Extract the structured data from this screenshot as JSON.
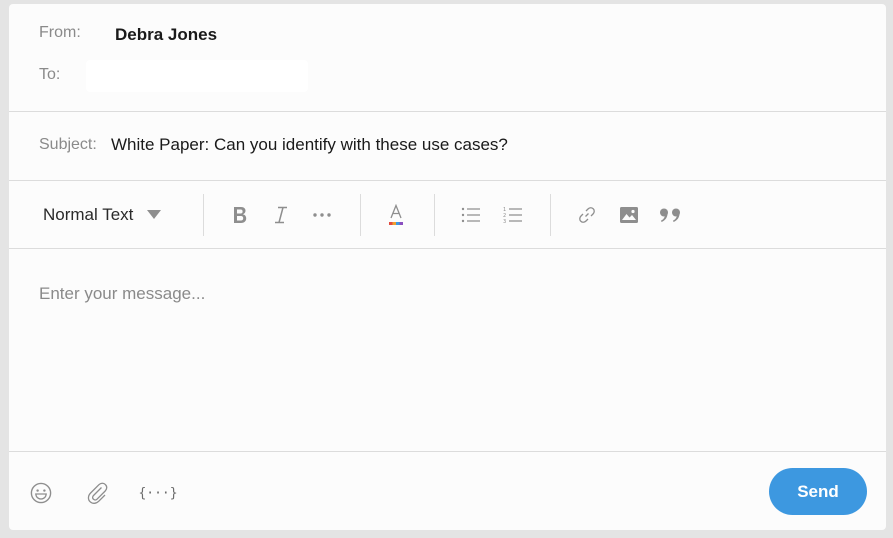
{
  "header": {
    "from_label": "From:",
    "from_value": "Debra Jones",
    "to_label": "To:",
    "to_value": ""
  },
  "subject": {
    "label": "Subject:",
    "value": "White Paper: Can you identify with these use cases?"
  },
  "toolbar": {
    "text_style": "Normal Text",
    "icons": [
      "bold-icon",
      "italic-icon",
      "more-icon",
      "text-color-icon",
      "bulleted-list-icon",
      "numbered-list-icon",
      "link-icon",
      "image-icon",
      "quote-icon"
    ]
  },
  "editor": {
    "placeholder": "Enter your message..."
  },
  "footer": {
    "icons": [
      "emoji-icon",
      "attachment-icon",
      "variables-icon"
    ],
    "variables_label": "{···}",
    "send_label": "Send"
  },
  "colors": {
    "accent": "#3d98e0",
    "background": "#e4e4e4",
    "card": "#fcfcfc"
  }
}
